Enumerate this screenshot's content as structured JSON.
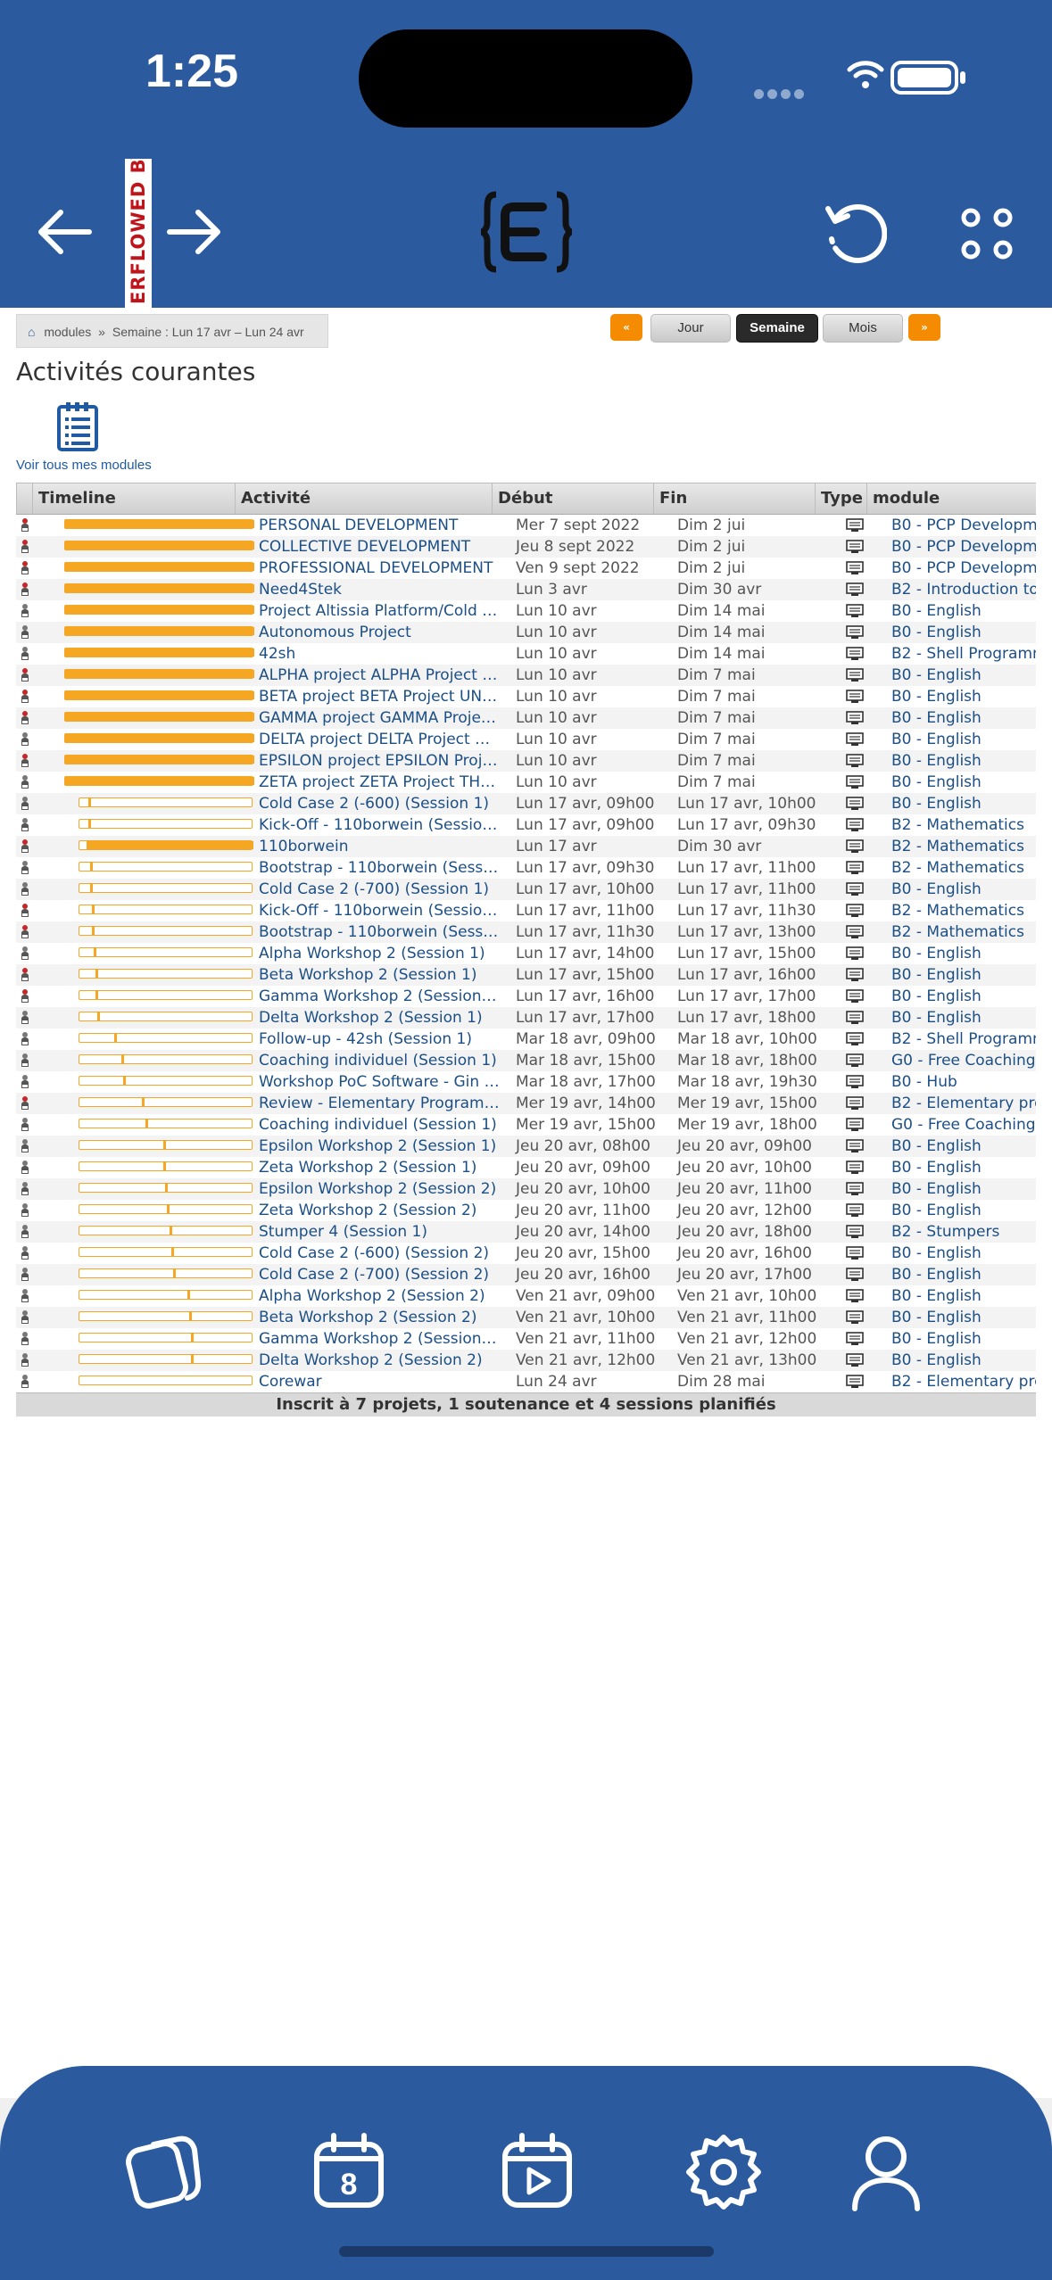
{
  "status_bar": {
    "time": "1:25"
  },
  "ribbon_text": "ERFLOWED BY",
  "breadcrumb": {
    "root": "modules",
    "separator": "»",
    "week": "Semaine : Lun 17 avr –  Lun 24 avr"
  },
  "view_buttons": {
    "prev": "«",
    "day": "Jour",
    "week": "Semaine",
    "month": "Mois",
    "next": "»",
    "selected": "Semaine"
  },
  "page_title": "Activités courantes",
  "modules_link": "Voir tous mes modules",
  "table": {
    "headers": {
      "timeline": "Timeline",
      "activity": "Activité",
      "start": "Début",
      "end": "Fin",
      "type": "Type",
      "module": "module"
    },
    "rows": [
      {
        "icon": "red",
        "activity": "PERSONAL DEVELOPMENT",
        "start": "Mer 7 sept 2022",
        "end": "Dim 2 jui",
        "module": "B0 - PCP Developme",
        "progress": 1.0
      },
      {
        "icon": "red",
        "activity": "COLLECTIVE DEVELOPMENT",
        "start": "Jeu 8 sept 2022",
        "end": "Dim 2 jui",
        "module": "B0 - PCP Developme",
        "progress": 1.0
      },
      {
        "icon": "red",
        "activity": "PROFESSIONAL DEVELOPMENT",
        "start": "Ven 9 sept 2022",
        "end": "Dim 2 jui",
        "module": "B0 - PCP Developme",
        "progress": 1.0
      },
      {
        "icon": "red",
        "activity": "Need4Stek",
        "start": "Lun 3 avr",
        "end": "Dim 30 avr",
        "module": "B2 - Introduction to",
        "progress": 1.0
      },
      {
        "icon": "gray",
        "activity": "Project Altissia Platform/Cold ca...",
        "start": "Lun 10 avr",
        "end": "Dim 14 mai",
        "module": "B0 - English",
        "progress": 1.0
      },
      {
        "icon": "gray",
        "activity": "Autonomous Project",
        "start": "Lun 10 avr",
        "end": "Dim 14 mai",
        "module": "B0 - English",
        "progress": 1.0
      },
      {
        "icon": "gray",
        "activity": "42sh",
        "start": "Lun 10 avr",
        "end": "Dim 14 mai",
        "module": "B2 - Shell Programm",
        "progress": 1.0
      },
      {
        "icon": "red",
        "activity": "ALPHA project ALPHA Project M...",
        "start": "Lun 10 avr",
        "end": "Dim 7 mai",
        "module": "B0 - English",
        "progress": 1.0
      },
      {
        "icon": "red",
        "activity": "BETA project BETA Project UNIT...",
        "start": "Lun 10 avr",
        "end": "Dim 7 mai",
        "module": "B0 - English",
        "progress": 1.0
      },
      {
        "icon": "red",
        "activity": "GAMMA project GAMMA Project ...",
        "start": "Lun 10 avr",
        "end": "Dim 7 mai",
        "module": "B0 - English",
        "progress": 1.0
      },
      {
        "icon": "gray",
        "activity": "DELTA project DELTA Project A ...",
        "start": "Lun 10 avr",
        "end": "Dim 7 mai",
        "module": "B0 - English",
        "progress": 1.0
      },
      {
        "icon": "red",
        "activity": "EPSILON project EPSILON Proje...",
        "start": "Lun 10 avr",
        "end": "Dim 7 mai",
        "module": "B0 - English",
        "progress": 1.0
      },
      {
        "icon": "gray",
        "activity": "ZETA project ZETA Project THE ...",
        "start": "Lun 10 avr",
        "end": "Dim 7 mai",
        "module": "B0 - English",
        "progress": 1.0
      },
      {
        "icon": "gray",
        "activity": "Cold Case 2 (-600) (Session 1)",
        "start": "Lun 17 avr, 09h00",
        "end": "Lun 17 avr, 10h00",
        "module": "B0 - English",
        "mark": 0.05
      },
      {
        "icon": "gray",
        "activity": "Kick-Off - 110borwein (Session ...",
        "start": "Lun 17 avr, 09h00",
        "end": "Lun 17 avr, 09h30",
        "module": "B2 - Mathematics",
        "mark": 0.05
      },
      {
        "icon": "red",
        "activity": "110borwein",
        "start": "Lun 17 avr",
        "end": "Dim 30 avr",
        "module": "B2 - Mathematics",
        "progress": 0.96,
        "offset": 0.04
      },
      {
        "icon": "gray",
        "activity": "Bootstrap - 110borwein (Sessio...",
        "start": "Lun 17 avr, 09h30",
        "end": "Lun 17 avr, 11h00",
        "module": "B2 - Mathematics",
        "mark": 0.06
      },
      {
        "icon": "gray",
        "activity": "Cold Case 2 (-700) (Session 1)",
        "start": "Lun 17 avr, 10h00",
        "end": "Lun 17 avr, 11h00",
        "module": "B0 - English",
        "mark": 0.06
      },
      {
        "icon": "red",
        "activity": "Kick-Off - 110borwein (Session ...",
        "start": "Lun 17 avr, 11h00",
        "end": "Lun 17 avr, 11h30",
        "module": "B2 - Mathematics",
        "mark": 0.07
      },
      {
        "icon": "red",
        "activity": "Bootstrap - 110borwein (Sessio...",
        "start": "Lun 17 avr, 11h30",
        "end": "Lun 17 avr, 13h00",
        "module": "B2 - Mathematics",
        "mark": 0.07
      },
      {
        "icon": "gray",
        "activity": "Alpha Workshop 2 (Session 1)",
        "start": "Lun 17 avr, 14h00",
        "end": "Lun 17 avr, 15h00",
        "module": "B0 - English",
        "mark": 0.08
      },
      {
        "icon": "red",
        "activity": "Beta Workshop 2 (Session 1)",
        "start": "Lun 17 avr, 15h00",
        "end": "Lun 17 avr, 16h00",
        "module": "B0 - English",
        "mark": 0.09
      },
      {
        "icon": "red",
        "activity": "Gamma Workshop 2 (Session 1)",
        "start": "Lun 17 avr, 16h00",
        "end": "Lun 17 avr, 17h00",
        "module": "B0 - English",
        "mark": 0.09
      },
      {
        "icon": "gray",
        "activity": "Delta Workshop 2 (Session 1)",
        "start": "Lun 17 avr, 17h00",
        "end": "Lun 17 avr, 18h00",
        "module": "B0 - English",
        "mark": 0.1
      },
      {
        "icon": "gray",
        "activity": "Follow-up - 42sh (Session 1)",
        "start": "Mar 18 avr, 09h00",
        "end": "Mar 18 avr, 10h00",
        "module": "B2 - Shell Programm",
        "mark": 0.2
      },
      {
        "icon": "gray",
        "activity": "Coaching individuel (Session 1)",
        "start": "Mar 18 avr, 15h00",
        "end": "Mar 18 avr, 18h00",
        "module": "G0 - Free Coaching",
        "mark": 0.24
      },
      {
        "icon": "gray",
        "activity": "Workshop PoC Software - Gin f...",
        "start": "Mar 18 avr, 17h00",
        "end": "Mar 18 avr, 19h30",
        "module": "B0 - Hub",
        "mark": 0.25
      },
      {
        "icon": "red",
        "activity": "Review - Elementary Programm...",
        "start": "Mer 19 avr, 14h00",
        "end": "Mer 19 avr, 15h00",
        "module": "B2 - Elementary pro",
        "mark": 0.36
      },
      {
        "icon": "gray",
        "activity": "Coaching individuel (Session 1)",
        "start": "Mer 19 avr, 15h00",
        "end": "Mer 19 avr, 18h00",
        "module": "G0 - Free Coaching",
        "mark": 0.38
      },
      {
        "icon": "gray",
        "activity": "Epsilon Workshop 2 (Session 1)",
        "start": "Jeu 20 avr, 08h00",
        "end": "Jeu 20 avr, 09h00",
        "module": "B0 - English",
        "mark": 0.48
      },
      {
        "icon": "gray",
        "activity": "Zeta Workshop 2 (Session 1)",
        "start": "Jeu 20 avr, 09h00",
        "end": "Jeu 20 avr, 10h00",
        "module": "B0 - English",
        "mark": 0.48
      },
      {
        "icon": "gray",
        "activity": "Epsilon Workshop 2 (Session 2)",
        "start": "Jeu 20 avr, 10h00",
        "end": "Jeu 20 avr, 11h00",
        "module": "B0 - English",
        "mark": 0.49
      },
      {
        "icon": "gray",
        "activity": "Zeta Workshop 2 (Session 2)",
        "start": "Jeu 20 avr, 11h00",
        "end": "Jeu 20 avr, 12h00",
        "module": "B0 - English",
        "mark": 0.5
      },
      {
        "icon": "gray",
        "activity": "Stumper 4 (Session 1)",
        "start": "Jeu 20 avr, 14h00",
        "end": "Jeu 20 avr, 18h00",
        "module": "B2 - Stumpers",
        "mark": 0.52
      },
      {
        "icon": "gray",
        "activity": "Cold Case 2 (-600) (Session 2)",
        "start": "Jeu 20 avr, 15h00",
        "end": "Jeu 20 avr, 16h00",
        "module": "B0 - English",
        "mark": 0.53
      },
      {
        "icon": "gray",
        "activity": "Cold Case 2 (-700) (Session 2)",
        "start": "Jeu 20 avr, 16h00",
        "end": "Jeu 20 avr, 17h00",
        "module": "B0 - English",
        "mark": 0.54
      },
      {
        "icon": "gray",
        "activity": "Alpha Workshop 2 (Session 2)",
        "start": "Ven 21 avr, 09h00",
        "end": "Ven 21 avr, 10h00",
        "module": "B0 - English",
        "mark": 0.62
      },
      {
        "icon": "gray",
        "activity": "Beta Workshop 2 (Session 2)",
        "start": "Ven 21 avr, 10h00",
        "end": "Ven 21 avr, 11h00",
        "module": "B0 - English",
        "mark": 0.63
      },
      {
        "icon": "gray",
        "activity": "Gamma Workshop 2 (Session 2)",
        "start": "Ven 21 avr, 11h00",
        "end": "Ven 21 avr, 12h00",
        "module": "B0 - English",
        "mark": 0.64
      },
      {
        "icon": "gray",
        "activity": "Delta Workshop 2 (Session 2)",
        "start": "Ven 21 avr, 12h00",
        "end": "Ven 21 avr, 13h00",
        "module": "B0 - English",
        "mark": 0.64
      },
      {
        "icon": "gray",
        "activity": "Corewar",
        "start": "Lun 24 avr",
        "end": "Dim 28 mai",
        "module": "B2 - Elementary pro",
        "progress": 0.0
      }
    ],
    "footer": "Inscrit à 7 projets, 1 soutenance et 4 sessions planifiés"
  },
  "colors": {
    "brand_blue": "#2b5b9e",
    "timeline_orange": "#f5a623",
    "nav_orange": "#f58b00",
    "ribbon_red": "#c0141b"
  },
  "bottom_tabs": [
    {
      "name": "tab-home",
      "icon": "stacked-cards-icon"
    },
    {
      "name": "tab-calendar",
      "icon": "calendar-icon",
      "badge": "8"
    },
    {
      "name": "tab-media",
      "icon": "video-calendar-icon"
    },
    {
      "name": "tab-settings",
      "icon": "gear-icon"
    },
    {
      "name": "tab-profile",
      "icon": "person-icon"
    }
  ]
}
